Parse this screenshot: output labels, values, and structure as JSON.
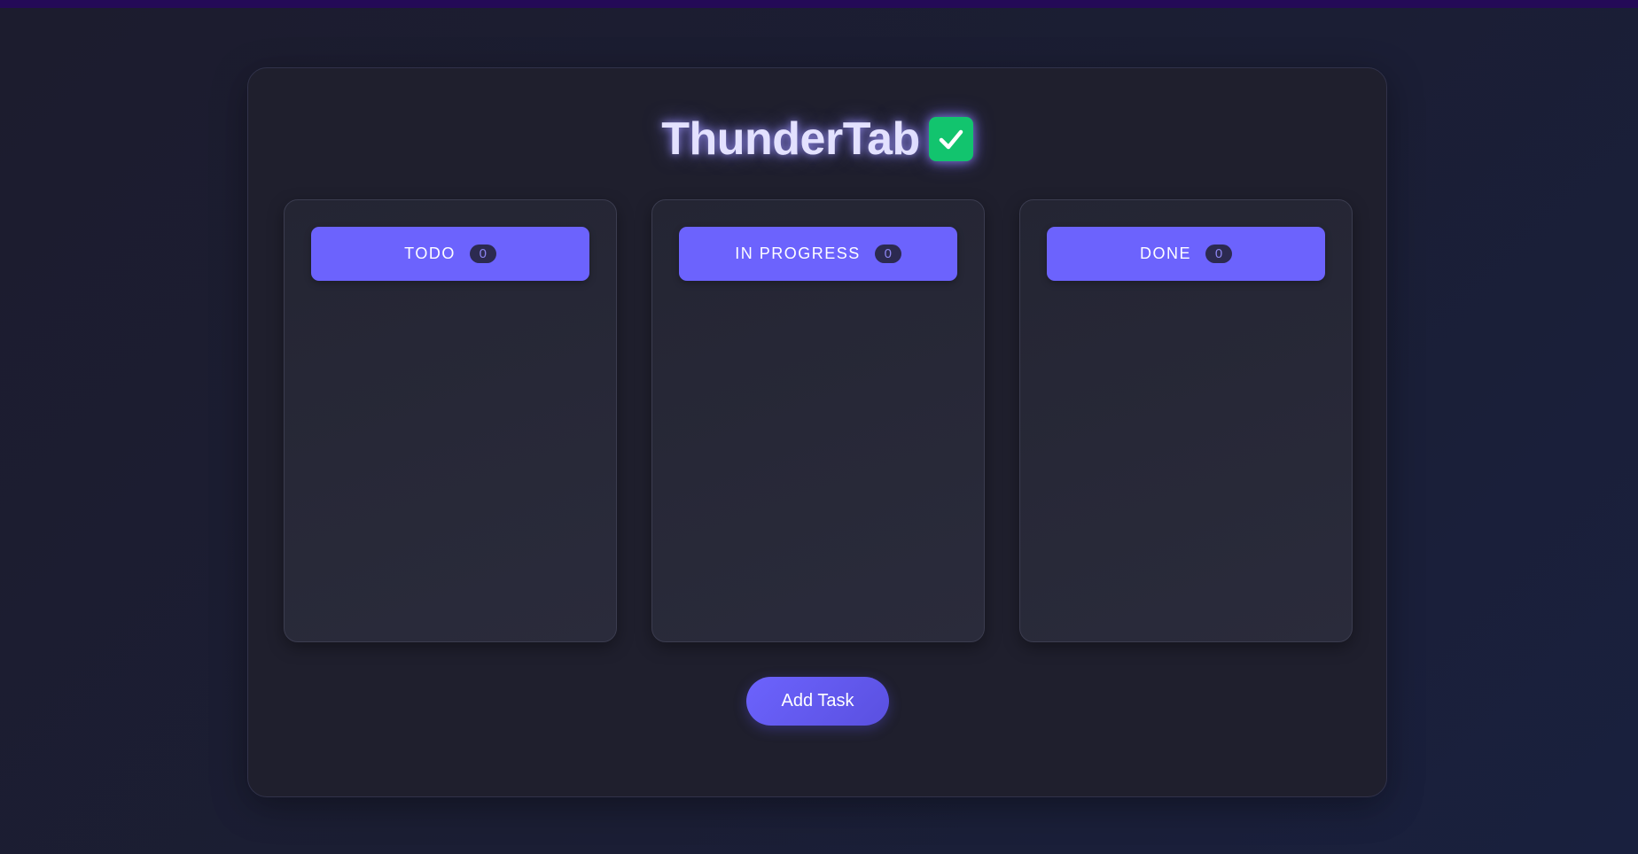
{
  "app": {
    "title": "ThunderTab",
    "title_icon": "check-mark-icon"
  },
  "colors": {
    "background": "#1c1c2e",
    "panel": "#1f1f2d",
    "column": "#262736",
    "accent": "#6c63fd",
    "badge": "#2c2a50",
    "check_icon": "#12c46e",
    "title_glow": "#e3e1ff"
  },
  "columns": [
    {
      "title": "TODO",
      "count": "0"
    },
    {
      "title": "IN PROGRESS",
      "count": "0"
    },
    {
      "title": "DONE",
      "count": "0"
    }
  ],
  "actions": {
    "add_task_label": "Add Task"
  }
}
